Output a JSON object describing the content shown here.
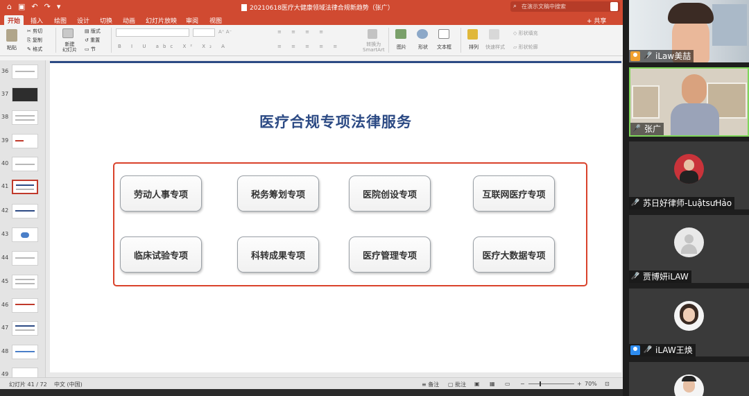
{
  "window": {
    "title": "20210618医疗大健康领域法律合规新趋势（张广）",
    "search_placeholder": "在演示文稿中搜索"
  },
  "menu_tabs": [
    "开始",
    "插入",
    "绘图",
    "设计",
    "切换",
    "动画",
    "幻灯片放映",
    "审阅",
    "视图"
  ],
  "share_label": "共享",
  "ribbon": {
    "paste": "粘贴",
    "cut": "剪切",
    "copy": "复制",
    "format": "格式",
    "new_slide": "新建\n幻灯片",
    "layout": "版式",
    "reset": "重置",
    "section": "节",
    "convert_smartart": "转换为\nSmartArt",
    "picture": "图片",
    "shapes": "形状",
    "textbox": "文本框",
    "arrange": "排列",
    "quick_styles": "快速样式",
    "shape_fill": "形状填充",
    "shape_outline": "形状轮廓"
  },
  "thumbnails": [
    {
      "num": "36",
      "style": "light"
    },
    {
      "num": "37",
      "style": "dark"
    },
    {
      "num": "38",
      "style": "light"
    },
    {
      "num": "39",
      "style": "light"
    },
    {
      "num": "40",
      "style": "light"
    },
    {
      "num": "41",
      "style": "selected"
    },
    {
      "num": "42",
      "style": "light"
    },
    {
      "num": "43",
      "style": "light"
    },
    {
      "num": "44",
      "style": "light"
    },
    {
      "num": "45",
      "style": "light"
    },
    {
      "num": "46",
      "style": "light"
    },
    {
      "num": "47",
      "style": "light"
    },
    {
      "num": "48",
      "style": "light"
    },
    {
      "num": "49",
      "style": "light"
    }
  ],
  "slide": {
    "title": "医疗合规专项法律服务",
    "services": [
      "劳动人事专项",
      "税务筹划专项",
      "医院创设专项",
      "互联网医疗专项",
      "临床试验专项",
      "科转成果专项",
      "医疗管理专项",
      "医疗大数据专项"
    ]
  },
  "status": {
    "slide_position": "幻灯片 41 / 72",
    "language": "中文 (中国)",
    "notes": "备注",
    "comments": "批注",
    "zoom": "70%"
  },
  "participants": [
    {
      "name": "iLaw美喆",
      "badge": "host-orange",
      "muted": true
    },
    {
      "name": "张广",
      "badge": "none",
      "muted": false,
      "active_speaker": true
    },
    {
      "name": "苏日好律师-LuậtsưHảo",
      "badge": "none",
      "muted": true
    },
    {
      "name": "贾博妍iLAW",
      "badge": "none",
      "muted": true
    },
    {
      "name": "iLAW王焕",
      "badge": "host-blue",
      "muted": true
    },
    {
      "name": "",
      "badge": "none",
      "muted": false
    }
  ],
  "colors": {
    "ribbon_accent": "#d04a31",
    "slide_title": "#2c4a84",
    "frame_border": "#d9412a",
    "active_speaker_border": "#7fd65a"
  }
}
